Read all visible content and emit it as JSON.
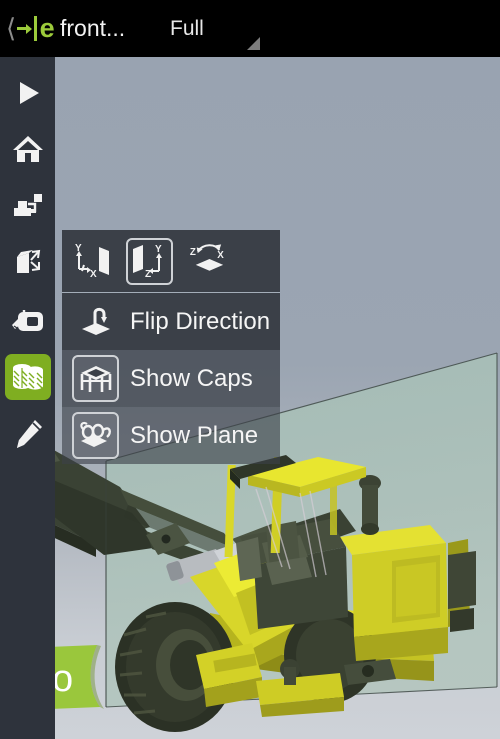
{
  "app": {
    "brand_mark": "e",
    "brand_colors": {
      "green": "#9ccb3b",
      "accent_green": "#7fae21",
      "badge_green": "#9ac73c"
    }
  },
  "topbar": {
    "back_icon": "back-chevron-icon",
    "logo_icon": "eDrawings-logo-icon",
    "logo_letter": "e",
    "document_title": "front...",
    "mode_selector": {
      "label": "Full",
      "dropdown_icon": "corner-dropdown-triangle-icon"
    },
    "fit_button": {
      "icon": "fit-to-window-icon"
    },
    "share_button": {
      "icon": "share-icon",
      "dropdown_icon": "corner-dropdown-triangle-icon"
    },
    "overflow_button": {
      "icon": "more-vertical-icon"
    }
  },
  "sidebar": {
    "background": "#2e333c",
    "items": [
      {
        "name": "play-animation",
        "icon": "play-triangle-icon",
        "active": false
      },
      {
        "name": "home-view",
        "icon": "home-icon",
        "active": false
      },
      {
        "name": "explode-view",
        "icon": "explode-assembly-icon",
        "active": false
      },
      {
        "name": "components",
        "icon": "cube-components-icon",
        "active": false
      },
      {
        "name": "measure",
        "icon": "measure-tape-icon",
        "active": false
      },
      {
        "name": "section-view",
        "icon": "section-cylinder-icon",
        "active": true
      },
      {
        "name": "markup",
        "icon": "pencil-markup-icon",
        "active": false
      }
    ]
  },
  "section_menu": {
    "axis_buttons": [
      {
        "name": "plane-yx",
        "icon": "plane-yx-axis-icon",
        "labels": [
          "Y",
          "X"
        ],
        "selected": false
      },
      {
        "name": "plane-yz",
        "icon": "plane-yz-axis-icon",
        "labels": [
          "Y",
          "Z"
        ],
        "selected": true
      },
      {
        "name": "plane-zx",
        "icon": "plane-zx-axis-icon",
        "labels": [
          "Z",
          "X"
        ],
        "selected": false
      }
    ],
    "items": [
      {
        "name": "flip-direction",
        "label": "Flip Direction",
        "icon": "flip-direction-icon",
        "framed": false
      },
      {
        "name": "show-caps",
        "label": "Show Caps",
        "icon": "show-caps-icon",
        "framed": true
      },
      {
        "name": "show-plane",
        "label": "Show Plane",
        "icon": "show-plane-icon",
        "framed": true
      }
    ]
  },
  "viewport": {
    "model_name": "wheel-loader-3d-model",
    "background_top": "#9aa4b2",
    "background_bottom": "#ccd1d7",
    "section_plane_color": "#a9c1b9",
    "model_colors": {
      "body": "#d8d62a",
      "body_dark": "#8e8f1c",
      "tire": "#2b3125",
      "glass": "#3c4138"
    }
  },
  "pro_badge": {
    "label": "Pro",
    "color": "#9ac73c"
  }
}
